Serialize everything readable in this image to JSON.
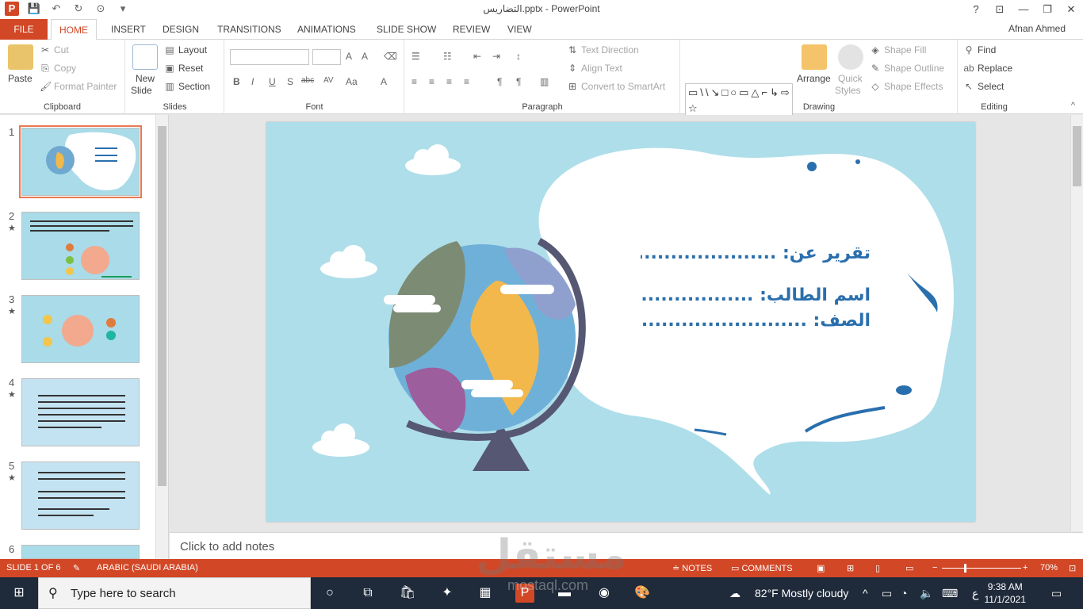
{
  "app": {
    "title": "التضاريس.pptx - PowerPoint",
    "user": "Afnan Ahmed"
  },
  "tabs": [
    {
      "label": "FILE"
    },
    {
      "label": "HOME"
    },
    {
      "label": "INSERT"
    },
    {
      "label": "DESIGN"
    },
    {
      "label": "TRANSITIONS"
    },
    {
      "label": "ANIMATIONS"
    },
    {
      "label": "SLIDE SHOW"
    },
    {
      "label": "REVIEW"
    },
    {
      "label": "VIEW"
    }
  ],
  "ribbon": {
    "clipboard": {
      "label": "Clipboard",
      "paste": "Paste",
      "cut": "Cut",
      "copy": "Copy",
      "format_painter": "Format Painter"
    },
    "slides": {
      "label": "Slides",
      "new_slide_1": "New",
      "new_slide_2": "Slide",
      "layout": "Layout",
      "reset": "Reset",
      "section": "Section"
    },
    "font": {
      "label": "Font",
      "bold": "B",
      "italic": "I",
      "underline": "U",
      "shadow": "S",
      "strike": "abc",
      "spacing": "AV",
      "case": "Aa",
      "color": "A",
      "grow": "A",
      "shrink": "A"
    },
    "paragraph": {
      "label": "Paragraph",
      "text_direction": "Text Direction",
      "align_text": "Align Text",
      "convert_smartart": "Convert to SmartArt"
    },
    "drawing": {
      "label": "Drawing",
      "arrange": "Arrange",
      "quick_styles_1": "Quick",
      "quick_styles_2": "Styles",
      "shape_fill": "Shape Fill",
      "shape_outline": "Shape Outline",
      "shape_effects": "Shape Effects",
      "shapes_gallery": "▭\\\\↘□○▭△⌐↳⇨⇩☆⚡⌒⌒{}☆"
    },
    "editing": {
      "label": "Editing",
      "find": "Find",
      "replace": "Replace",
      "select": "Select"
    }
  },
  "slides_panel": [
    {
      "num": "1",
      "star": ""
    },
    {
      "num": "2",
      "star": "★"
    },
    {
      "num": "3",
      "star": "★"
    },
    {
      "num": "4",
      "star": "★"
    },
    {
      "num": "5",
      "star": "★"
    },
    {
      "num": "6",
      "star": "★"
    }
  ],
  "slide": {
    "line1": "تقرير عن: ........................",
    "line2": "اسم الطالب: ......................",
    "line3": "الصف: ...........................",
    "bg_color": "#aedeea",
    "text_color": "#2a6fad"
  },
  "notes": {
    "placeholder": "Click to add notes"
  },
  "status": {
    "slide_of": "SLIDE 1 OF 6",
    "language": "ARABIC (SAUDI ARABIA)",
    "notes": "NOTES",
    "comments": "COMMENTS",
    "zoom": "70%"
  },
  "taskbar": {
    "search_placeholder": "Type here to search",
    "weather": "82°F  Mostly cloudy",
    "time": "9:38 AM",
    "date": "11/1/2021",
    "ime": "ع"
  },
  "watermark": {
    "text": "مستقل",
    "sub": "mostaql.com"
  }
}
